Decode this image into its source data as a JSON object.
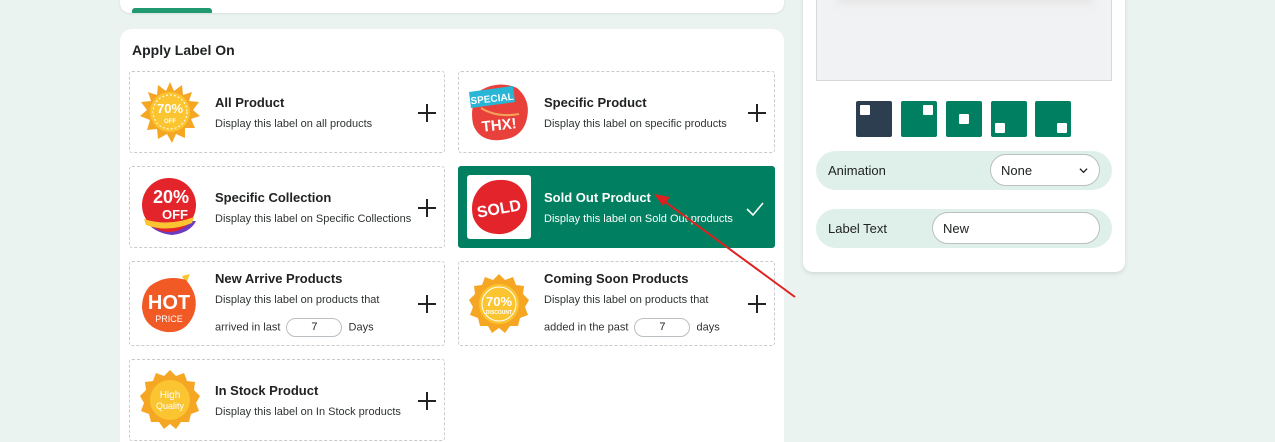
{
  "section_title": "Apply Label On",
  "options": [
    {
      "title": "All Product",
      "desc": "Display this label on all products",
      "badge": "70% OFF"
    },
    {
      "title": "Specific Product",
      "desc": "Display this label on specific products",
      "badge": "SPECIAL THX!"
    },
    {
      "title": "Specific Collection",
      "desc": "Display this label on Specific Collections",
      "badge": "20% OFF"
    },
    {
      "title": "Sold Out Product",
      "desc": "Display this label on Sold Out products",
      "badge": "SOLD",
      "selected": true
    },
    {
      "title": "New Arrive Products",
      "desc_line1": "Display this label on products that",
      "desc_prefix": "arrived in last",
      "days": "7",
      "desc_suffix": "Days",
      "badge": "HOT PRICE"
    },
    {
      "title": "Coming Soon Products",
      "desc_line1": "Display this label on products that",
      "desc_prefix": "added in the past",
      "days": "7",
      "desc_suffix": "days",
      "badge": "70% DISCOUNT"
    },
    {
      "title": "In Stock Product",
      "desc": "Display this label on In Stock products",
      "badge": "High Quality"
    }
  ],
  "settings": {
    "animation_label": "Animation",
    "animation_value": "None",
    "label_text_label": "Label Text",
    "label_text_value": "New"
  },
  "colors": {
    "accent": "#008060",
    "selected_position": "#2c3e50",
    "arrow": "#e02020"
  },
  "icons": [
    "plus-icon",
    "check-icon",
    "chevron-down-icon"
  ]
}
